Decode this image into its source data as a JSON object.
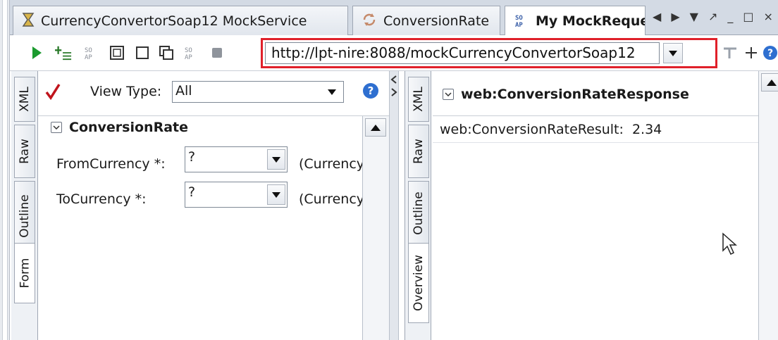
{
  "tabs": [
    {
      "label": "CurrencyConvertorSoap12 MockService",
      "icon": "mock-service-icon",
      "active": false
    },
    {
      "label": "ConversionRate",
      "icon": "mock-operation-icon",
      "active": false
    },
    {
      "label": "My MockReque",
      "icon": "soap-request-icon",
      "active": true
    }
  ],
  "tab_nav": {
    "prev": "◀",
    "next": "▶",
    "list": "▼",
    "restore": "↗",
    "minimize": "_",
    "maximize": "□",
    "close": "×"
  },
  "toolbar": {
    "endpoint_url": "http://lpt-nire:8088/mockCurrencyConvertorSoap12",
    "buttons": [
      "run-icon",
      "add-assertion-icon",
      "soap-icon",
      "wsdl-icon",
      "square-icon",
      "copy-icon",
      "soap-small-icon",
      "stop-icon"
    ],
    "help_label": "?"
  },
  "request_tabs": [
    "XML",
    "Raw",
    "Outline",
    "Form"
  ],
  "request": {
    "view_type_label": "View Type:",
    "view_type_value": "All",
    "help_label": "?",
    "section_title": "ConversionRate",
    "fields": [
      {
        "label": "FromCurrency *:",
        "value": "?",
        "hint": "(Currency"
      },
      {
        "label": "ToCurrency *:",
        "value": "?",
        "hint": "(Currency"
      }
    ]
  },
  "response_tabs": [
    "XML",
    "Raw",
    "Outline",
    "Overview"
  ],
  "response": {
    "title": "web:ConversionRateResponse",
    "result_label": "web:ConversionRateResult:",
    "result_value": "2.34"
  },
  "colors": {
    "highlight_border": "#e0202a",
    "run_green": "#1b9a2e",
    "checkmark_red": "#c0141c",
    "help_blue": "#2e6fd0"
  }
}
